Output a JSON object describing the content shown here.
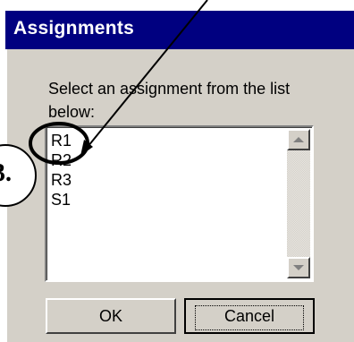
{
  "dialog": {
    "title": "Assignments",
    "prompt": "Select an assignment from the list below:"
  },
  "assignments": {
    "items": [
      "R1",
      "R2",
      "R3",
      "S1"
    ]
  },
  "buttons": {
    "ok": "OK",
    "cancel": "Cancel"
  },
  "annotation": {
    "step_label": "3.",
    "colors": {
      "stroke": "#000000"
    }
  },
  "colors": {
    "titlebar": "#000080",
    "face": "#d4d0c8"
  },
  "icons": {
    "scroll_up": "triangle-up-icon",
    "scroll_down": "triangle-down-icon"
  }
}
